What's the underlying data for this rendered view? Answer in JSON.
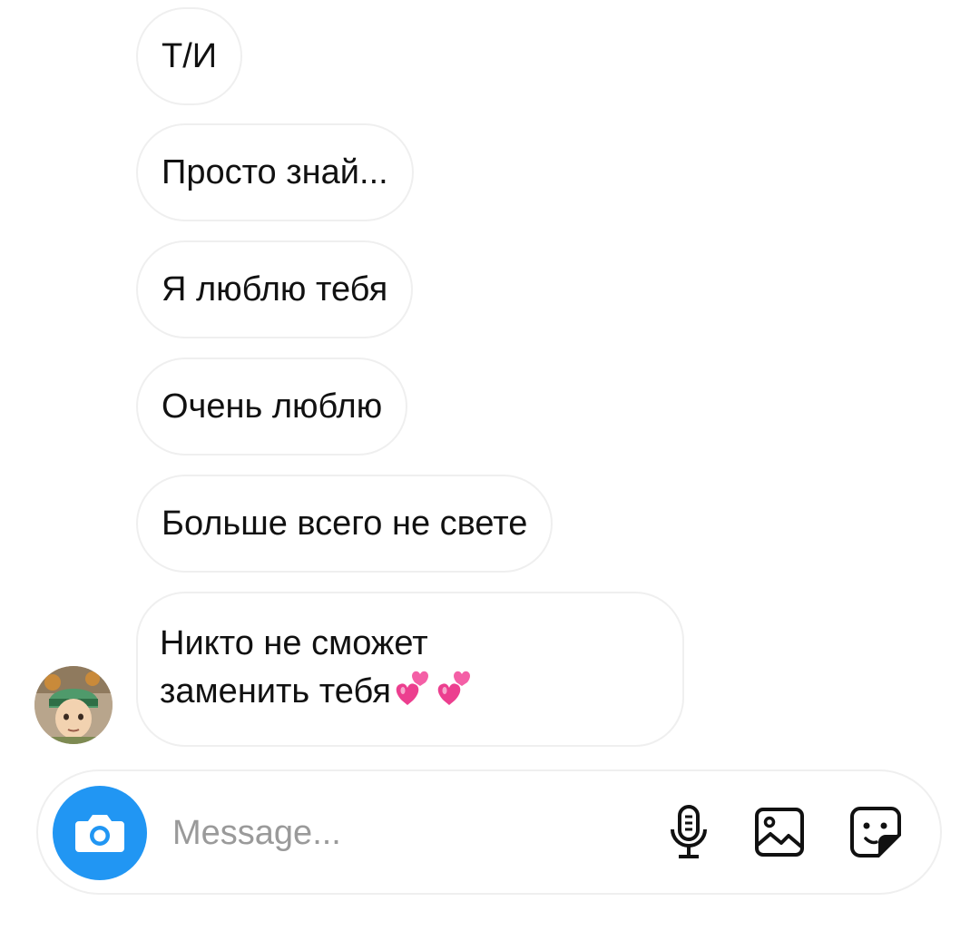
{
  "messages": [
    {
      "text": "Т/И"
    },
    {
      "text": "Просто знай..."
    },
    {
      "text": "Я люблю тебя"
    },
    {
      "text": "Очень люблю"
    },
    {
      "text": "Больше всего не свете"
    },
    {
      "line1": "Никто не сможет",
      "line2": "заменить тебя",
      "emoji": "💕💕"
    }
  ],
  "composer": {
    "placeholder": "Message...",
    "camera_icon": "camera-icon",
    "mic_icon": "microphone-icon",
    "gallery_icon": "gallery-icon",
    "sticker_icon": "sticker-icon"
  },
  "colors": {
    "camera_button": "#2196f3",
    "bubble_border": "#efefef",
    "placeholder": "#9a9a9a"
  }
}
